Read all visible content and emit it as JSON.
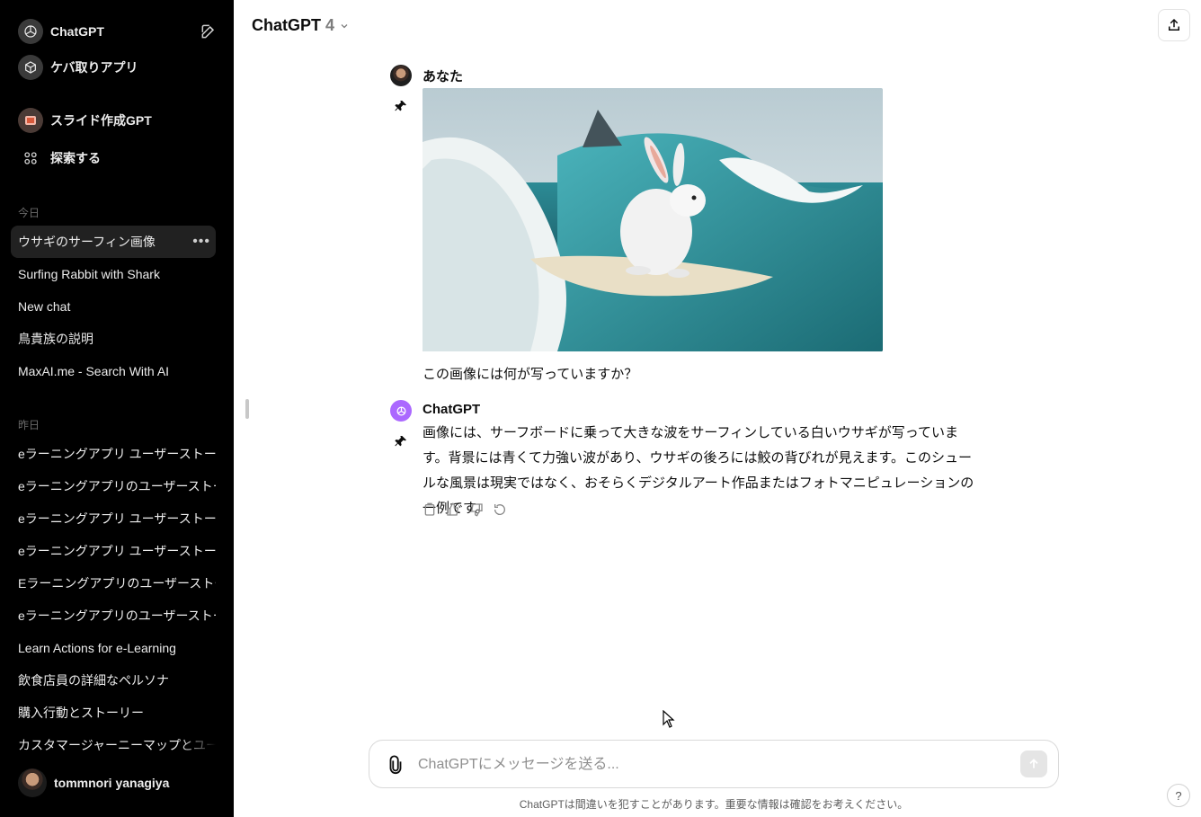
{
  "sidebar": {
    "app_name": "ChatGPT",
    "gpts": [
      {
        "label": "ケバ取りアプリ",
        "icon": "box-icon"
      },
      {
        "label": "スライド作成GPT",
        "icon": "slide-icon"
      }
    ],
    "explore_label": "探索する",
    "today_label": "今日",
    "today_items": [
      "ウサギのサーフィン画像",
      "Surfing Rabbit with Shark",
      "New chat",
      "鳥貴族の説明",
      "MaxAI.me - Search With AI"
    ],
    "yesterday_label": "昨日",
    "yesterday_items": [
      "eラーニングアプリ ユーザーストーリー",
      "eラーニングアプリのユーザーストーリー",
      "eラーニングアプリ ユーザーストーリー",
      "eラーニングアプリ ユーザーストーリー",
      "Eラーニングアプリのユーザーストーリー",
      "eラーニングアプリのユーザーストーリー",
      "Learn Actions for e-Learning",
      "飲食店員の詳細なペルソナ",
      "購入行動とストーリー",
      "カスタマージャーニーマップとユーザーストーリー"
    ],
    "user_name": "tommnori yanagiya"
  },
  "header": {
    "model_name": "ChatGPT",
    "model_version": "4"
  },
  "conversation": {
    "user_author": "あなた",
    "user_message": "この画像には何が写っていますか？",
    "assistant_author": "ChatGPT",
    "assistant_message": "画像には、サーフボードに乗って大きな波をサーフィンしている白いウサギが写っています。背景には青くて力強い波があり、ウサギの後ろには鮫の背びれが見えます。このシュールな風景は現実ではなく、おそらくデジタルアート作品またはフォトマニピュレーションの一例です。"
  },
  "composer": {
    "placeholder": "ChatGPTにメッセージを送る..."
  },
  "footer": {
    "disclaimer": "ChatGPTは間違いを犯すことがあります。重要な情報は確認をお考えください。",
    "help": "?"
  },
  "colors": {
    "sidebar_bg": "#000000",
    "active_item_bg": "#212121",
    "assistant_avatar": "#ab68ff"
  }
}
